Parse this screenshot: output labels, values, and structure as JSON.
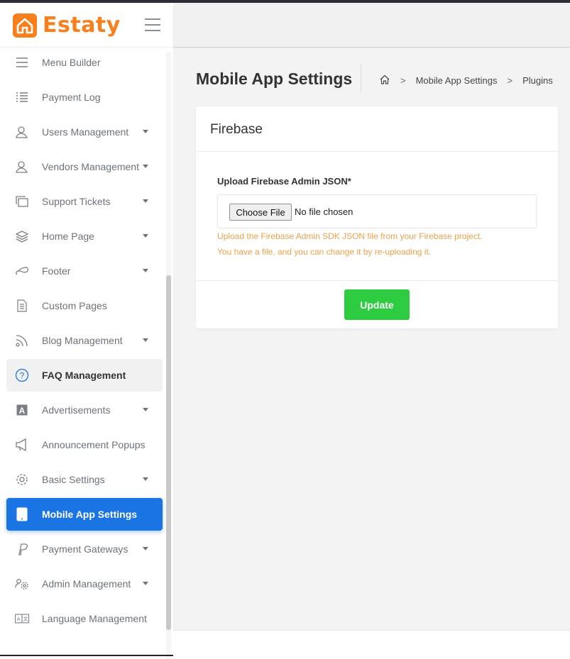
{
  "brand": {
    "name": "Estaty",
    "accent": "#f77f1c"
  },
  "sidebar": {
    "items": [
      {
        "label": "Menu Builder",
        "icon": "menu-icon",
        "has_caret": false,
        "state": "normal"
      },
      {
        "label": "Payment Log",
        "icon": "list-icon",
        "has_caret": false,
        "state": "normal"
      },
      {
        "label": "Users Management",
        "icon": "users-icon",
        "has_caret": true,
        "state": "normal"
      },
      {
        "label": "Vendors Management",
        "icon": "vendors-icon",
        "has_caret": true,
        "state": "normal"
      },
      {
        "label": "Support Tickets",
        "icon": "tickets-icon",
        "has_caret": true,
        "state": "normal"
      },
      {
        "label": "Home Page",
        "icon": "layers-icon",
        "has_caret": true,
        "state": "normal"
      },
      {
        "label": "Footer",
        "icon": "footer-icon",
        "has_caret": true,
        "state": "normal"
      },
      {
        "label": "Custom Pages",
        "icon": "page-icon",
        "has_caret": false,
        "state": "normal"
      },
      {
        "label": "Blog Management",
        "icon": "rss-icon",
        "has_caret": true,
        "state": "normal"
      },
      {
        "label": "FAQ Management",
        "icon": "question-icon",
        "has_caret": false,
        "state": "hover"
      },
      {
        "label": "Advertisements",
        "icon": "ad-icon",
        "has_caret": true,
        "state": "normal"
      },
      {
        "label": "Announcement Popups",
        "icon": "megaphone-icon",
        "has_caret": false,
        "state": "normal"
      },
      {
        "label": "Basic Settings",
        "icon": "gear-icon",
        "has_caret": true,
        "state": "normal"
      },
      {
        "label": "Mobile App Settings",
        "icon": "tablet-icon",
        "has_caret": false,
        "state": "active"
      },
      {
        "label": "Payment Gateways",
        "icon": "paypal-icon",
        "has_caret": true,
        "state": "normal"
      },
      {
        "label": "Admin Management",
        "icon": "admin-icon",
        "has_caret": true,
        "state": "normal"
      },
      {
        "label": "Language Management",
        "icon": "language-icon",
        "has_caret": false,
        "state": "normal"
      }
    ]
  },
  "main": {
    "page_title": "Mobile App Settings",
    "breadcrumb": {
      "home_icon": "home-icon",
      "items": [
        "Mobile App Settings",
        "Plugins"
      ]
    },
    "card": {
      "title": "Firebase",
      "field_label": "Upload Firebase Admin JSON*",
      "file_button": "Choose File",
      "file_status": "No file chosen",
      "hint_1": "Upload the Firebase Admin SDK JSON file from your Firebase project.",
      "hint_2": "You have a file, and you can change it by re-uploading it.",
      "submit_label": "Update"
    }
  },
  "colors": {
    "active": "#1b74e4",
    "submit": "#2ecc40",
    "hint": "#f0a04a"
  }
}
